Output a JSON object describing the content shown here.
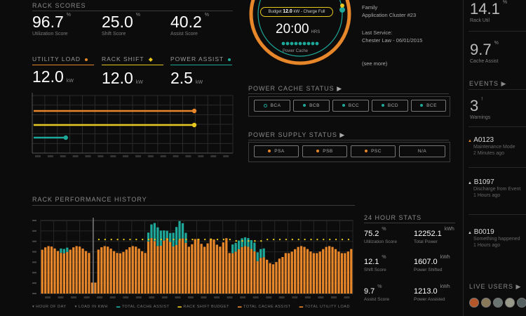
{
  "rack_scores": {
    "title": "RACK SCORES",
    "items": [
      {
        "value": "96.7",
        "unit": "%",
        "label": "Utilization Score"
      },
      {
        "value": "25.0",
        "unit": "%",
        "label": "Shift Score"
      },
      {
        "value": "40.2",
        "unit": "%",
        "label": "Assist Score"
      }
    ]
  },
  "loads": [
    {
      "title": "UTILITY LOAD",
      "value": "12.0",
      "unit": "kW",
      "color": "#e8862a"
    },
    {
      "title": "RACK SHIFT",
      "value": "12.0",
      "unit": "kW",
      "color": "#e8c81e"
    },
    {
      "title": "POWER ASSIST",
      "value": "2.5",
      "unit": "kW",
      "color": "#1ea89a"
    }
  ],
  "load_chart": {
    "bars": [
      {
        "pct": 100,
        "color": "#e8862a"
      },
      {
        "pct": 100,
        "color": "#e8c81e"
      },
      {
        "pct": 20,
        "color": "#1ea89a"
      }
    ]
  },
  "gauge": {
    "budget_prefix": "Budget",
    "budget_value": "12.0",
    "budget_suffix": "kW - Charge Full",
    "time": "20:00",
    "time_unit": "HRS",
    "label": "Power Cache"
  },
  "info": {
    "family_label": "Family",
    "family_value": "Application Cluster #23",
    "service_label": "Last Service:",
    "service_value": "Chester Law - 06/01/2015",
    "more": "(see more)"
  },
  "cache_status": {
    "title": "POWER CACHE STATUS",
    "items": [
      "BCA",
      "BCB",
      "BCC",
      "BCD",
      "BCE"
    ]
  },
  "supply_status": {
    "title": "POWER SUPPLY STATUS",
    "items": [
      "PSA",
      "PSB",
      "PSC",
      "N/A"
    ]
  },
  "right_panel": {
    "metric1": {
      "value": "14.1",
      "unit": "%",
      "label": "Rack Util"
    },
    "metric2": {
      "value": "9.7",
      "unit": "%",
      "label": "Cache Assist"
    },
    "events_title": "EVENTS",
    "events_count": "3",
    "events_count_label": "Warnings",
    "events": [
      {
        "id": "A0123",
        "desc": "Maintenance Mode",
        "time": "2 Minutes ago"
      },
      {
        "id": "B1097",
        "desc": "Discharge from Event",
        "time": "1 Hours ago"
      },
      {
        "id": "B0019",
        "desc": "Something happened",
        "time": "1 Hours ago"
      }
    ],
    "live_users_title": "LIVE USERS"
  },
  "history": {
    "title": "RACK PERFORMANCE HISTORY",
    "legend": [
      {
        "label": "HOUR OF DAY",
        "color": "#777777"
      },
      {
        "label": "LOAD IN KWH",
        "color": "#777777"
      },
      {
        "label": "TOTAL CACHE ASSIST",
        "color": "#1ea89a"
      },
      {
        "label": "RACK SHIFT BUDGET",
        "color": "#e8c81e"
      },
      {
        "label": "TOTAL CACHE ASSIST",
        "color": "#e8862a"
      },
      {
        "label": "TOTAL UTILITY LOAD",
        "color": "#e8862a"
      }
    ]
  },
  "stats": {
    "title": "24 HOUR STATS",
    "items": [
      {
        "value": "75.2",
        "unit": "%",
        "label": "Utilization Score"
      },
      {
        "value": "12252.1",
        "unit": "kWh",
        "label": "Total Power"
      },
      {
        "value": "12.1",
        "unit": "%",
        "label": "Shift Score"
      },
      {
        "value": "1607.0",
        "unit": "kWh",
        "label": "Power Shifted"
      },
      {
        "value": "9.7",
        "unit": "%",
        "label": "Assist Score"
      },
      {
        "value": "1213.0",
        "unit": "kWh",
        "label": "Power Assisted"
      }
    ]
  },
  "colors": {
    "orange": "#e8862a",
    "yellow": "#e8c81e",
    "teal": "#1ea89a"
  }
}
